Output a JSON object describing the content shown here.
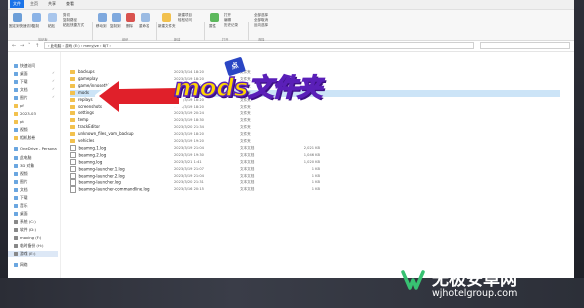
{
  "window": {
    "tabs": [
      "文件",
      "主页",
      "共享",
      "查看"
    ],
    "ribbon": {
      "pin_label": "固定到快速访问",
      "copy_label": "复制",
      "paste_label": "粘贴",
      "cut_label": "剪切",
      "copy_path_label": "复制路径",
      "paste_shortcut_label": "粘贴快捷方式",
      "move_to_label": "移动到",
      "copy_to_label": "复制到",
      "delete_label": "删除",
      "rename_label": "重命名",
      "new_folder_label": "新建文件夹",
      "new_item_label": "新建项目",
      "easy_access_label": "轻松访问",
      "properties_label": "属性",
      "open_label": "打开",
      "edit_label": "编辑",
      "history_label": "历史记录",
      "select_all_label": "全部选择",
      "select_none_label": "全部取消",
      "invert_label": "反向选择",
      "groups": [
        "剪贴板",
        "组织",
        "新建",
        "打开",
        "选择"
      ]
    },
    "address": "› 此电脑 › 游戏 (E:) › menyjve › BJT ›"
  },
  "sidebar": {
    "items": [
      {
        "label": "快速访问",
        "icon": "star-icon"
      },
      {
        "label": "桌面",
        "icon": "desktop-icon",
        "pinned": true
      },
      {
        "label": "下载",
        "icon": "download-icon",
        "pinned": true
      },
      {
        "label": "文档",
        "icon": "document-icon",
        "pinned": true
      },
      {
        "label": "图片",
        "icon": "picture-icon",
        "pinned": true
      },
      {
        "label": "pf",
        "icon": "folder-icon"
      },
      {
        "label": "2023-03",
        "icon": "folder-icon"
      },
      {
        "label": "pt",
        "icon": "folder-icon"
      },
      {
        "label": "视频",
        "icon": "video-icon"
      },
      {
        "label": "相机胶卷",
        "icon": "folder-icon"
      },
      {
        "label": "OneDrive - Persona",
        "icon": "cloud-icon"
      },
      {
        "label": "此电脑",
        "icon": "computer-icon"
      },
      {
        "label": "3D 对象",
        "icon": "cube-icon"
      },
      {
        "label": "视频",
        "icon": "video-icon"
      },
      {
        "label": "图片",
        "icon": "picture-icon"
      },
      {
        "label": "文档",
        "icon": "document-icon"
      },
      {
        "label": "下载",
        "icon": "download-icon"
      },
      {
        "label": "音乐",
        "icon": "music-icon"
      },
      {
        "label": "桌面",
        "icon": "desktop-icon"
      },
      {
        "label": "系统 (C:)",
        "icon": "drive-icon"
      },
      {
        "label": "软件 (D:)",
        "icon": "drive-icon"
      },
      {
        "label": "moxing (F:)",
        "icon": "drive-icon"
      },
      {
        "label": "临时备份 (H:)",
        "icon": "drive-icon"
      },
      {
        "label": "游戏 (E:)",
        "icon": "drive-icon",
        "selected": true
      },
      {
        "label": "网络",
        "icon": "network-icon"
      }
    ]
  },
  "files": {
    "rows": [
      {
        "name": "backups",
        "date": "2023/3/14 18:20",
        "type": "文件夹",
        "size": "",
        "kind": "folder"
      },
      {
        "name": "gameplay",
        "date": "2023/3/19 18:20",
        "type": "文件夹",
        "size": "",
        "kind": "folder"
      },
      {
        "name": "game/innosethie",
        "date": "2023/3/19 18:20",
        "type": "文件夹",
        "size": "",
        "kind": "folder"
      },
      {
        "name": "mods",
        "date": "2023/3/19 18:20",
        "type": "文件夹",
        "size": "",
        "kind": "folder",
        "highlight": true
      },
      {
        "name": "replays",
        "date": "2023/3/19 18:20",
        "type": "文件夹",
        "size": "",
        "kind": "folder"
      },
      {
        "name": "screenshots",
        "date": "2023/3/19 18:20",
        "type": "文件夹",
        "size": "",
        "kind": "folder"
      },
      {
        "name": "settings",
        "date": "2023/3/19 20:24",
        "type": "文件夹",
        "size": "",
        "kind": "folder"
      },
      {
        "name": "temp",
        "date": "2023/3/19 18:30",
        "type": "文件夹",
        "size": "",
        "kind": "folder"
      },
      {
        "name": "trackEditor",
        "date": "2023/3/20 21:34",
        "type": "文件夹",
        "size": "",
        "kind": "folder"
      },
      {
        "name": "unknown_files_vam_backup",
        "date": "2023/3/19 18:20",
        "type": "文件夹",
        "size": "",
        "kind": "folder"
      },
      {
        "name": "vehicles",
        "date": "2023/3/19 19:20",
        "type": "文件夹",
        "size": "",
        "kind": "folder"
      },
      {
        "name": "beamng.1.log",
        "date": "2023/3/19 21:04",
        "type": "文本文档",
        "size": "2,021 KB",
        "kind": "file"
      },
      {
        "name": "beamng.2.log",
        "date": "2023/3/19 19:30",
        "type": "文本文档",
        "size": "1,046 KB",
        "kind": "file"
      },
      {
        "name": "beamng.log",
        "date": "2023/3/21 1:41",
        "type": "文本文档",
        "size": "1,020 KB",
        "kind": "file"
      },
      {
        "name": "beamng-launcher.1.log",
        "date": "2023/3/19 21:07",
        "type": "文本文档",
        "size": "1 KB",
        "kind": "file"
      },
      {
        "name": "beamng-launcher.2.log",
        "date": "2023/3/19 21:04",
        "type": "文本文档",
        "size": "1 KB",
        "kind": "file"
      },
      {
        "name": "beamng-launcher.log",
        "date": "2023/3/20 21:31",
        "type": "文本文档",
        "size": "1 KB",
        "kind": "file"
      },
      {
        "name": "beamng-launcher-commandline.log",
        "date": "2023/3/16 20:15",
        "type": "文本文档",
        "size": "1 KB",
        "kind": "file"
      }
    ]
  },
  "overlay": {
    "caption": "mods文件夹",
    "badge": "点"
  },
  "watermark": {
    "name": "无极安卓网",
    "url": "wjhotelgroup.com"
  },
  "colors": {
    "caption_fill": "#ffd500",
    "caption_stroke": "#5a1fb8",
    "arrow_red": "#e0202a",
    "selection": "#cce4f7",
    "tab_blue": "#1a73e8"
  }
}
